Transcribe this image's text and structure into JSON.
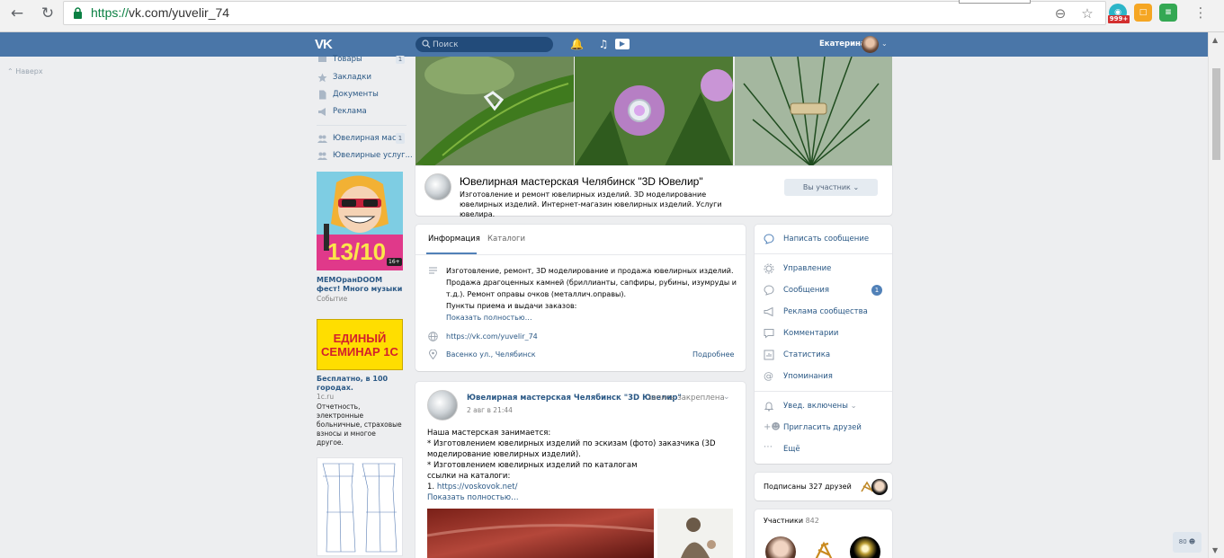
{
  "browser": {
    "url_scheme": "https://",
    "url_rest": "vk.com/yuvelir_74",
    "ext_badge": "999+"
  },
  "header": {
    "search_placeholder": "Поиск",
    "user_name": "Екатерина"
  },
  "to_top": "Наверх",
  "side_menu": {
    "items": [
      {
        "label": "Товары",
        "count": "1"
      },
      {
        "label": "Закладки"
      },
      {
        "label": "Документы"
      },
      {
        "label": "Реклама"
      }
    ],
    "groups": [
      {
        "label": "Ювелирная мас...",
        "count": "1"
      },
      {
        "label": "Ювелирные услуг..."
      }
    ]
  },
  "ads": [
    {
      "banner": {
        "big": "13/10",
        "age": "16+"
      },
      "title": "МЕМОранDOOM фест! Много музыки",
      "sub": "Событие"
    },
    {
      "banner": {
        "line1": "ЕДИНЫЙ",
        "line2": "СЕМИНАР 1С"
      },
      "title": "Бесплатно, в 100 городах.",
      "sub": "1c.ru",
      "text": "Отчетность, электронные больничные, страховые взносы и многое другое."
    }
  ],
  "group": {
    "name": "Ювелирная мастерская Челябинск \"3D Ювелир\"",
    "status": "Изготовление и ремонт ювелирных изделий. 3D моделирование ювелирных изделий. Интернет-магазин ювелирных изделий. Услуги ювелира.",
    "member_button": "Вы участник"
  },
  "info": {
    "tabs": [
      "Информация",
      "Каталоги"
    ],
    "description": "Изготовление, ремонт, 3D моделирование и продажа ювелирных изделий. Продажа драгоценных камней (бриллианты, сапфиры, рубины, изумруды и т.д.). Ремонт оправы очков (металлич.оправы).",
    "description_2": "Пункты приема и выдачи заказов:",
    "show_more": "Показать полностью…",
    "website": "https://vk.com/yuvelir_74",
    "address": "Васенко ул., Челябинск",
    "address_more": "Подробнее"
  },
  "actions": {
    "write": "Написать сообщение",
    "items": [
      "Управление",
      "Сообщения",
      "Реклама сообщества",
      "Комментарии",
      "Статистика",
      "Упоминания"
    ],
    "messages_badge": "1",
    "notify": "Увед. включены",
    "invite": "Пригласить друзей",
    "more": "Ещё"
  },
  "friends": {
    "label": "Подписаны 327 друзей"
  },
  "members": {
    "label": "Участники",
    "count": "842"
  },
  "post": {
    "author": "Ювелирная мастерская Челябинск \"3D Ювелир\"",
    "pinned": "запись закреплена",
    "date": "2 авг в 21:44",
    "lines": [
      "Наша мастерская занимается:",
      "* Изготовлением ювелирных изделий по эскизам (фото) заказчика (3D моделирование ювелирных изделий).",
      "* Изготовлением ювелирных изделий по каталогам",
      "ссылки на каталоги:"
    ],
    "link_prefix": "1. ",
    "link": "https://voskovok.net/",
    "show_more": "Показать полностью…"
  },
  "chat_widget": "80",
  "colors": {
    "vk_blue": "#4a76a8",
    "link": "#2a5885",
    "background": "#edeef0"
  }
}
